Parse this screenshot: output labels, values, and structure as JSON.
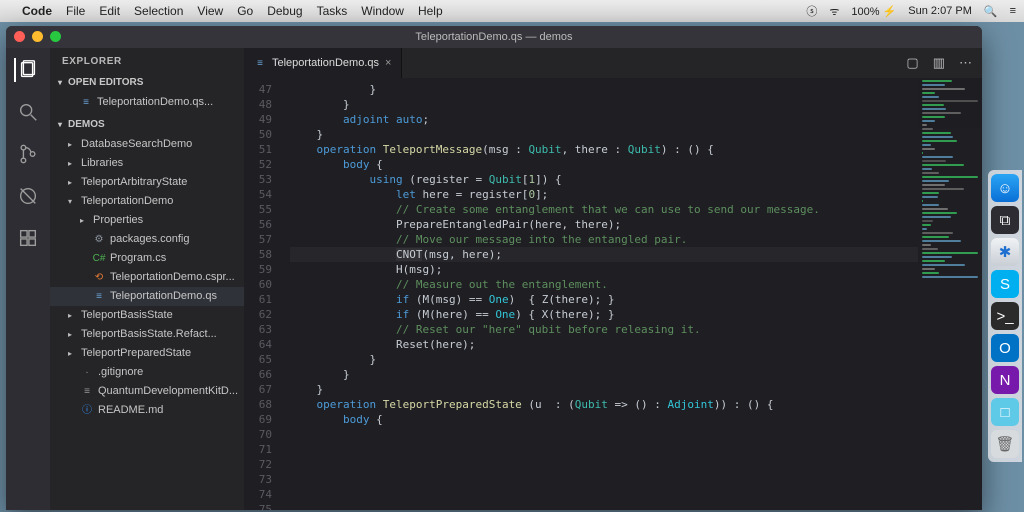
{
  "menubar": {
    "apple": "",
    "app": "Code",
    "items": [
      "File",
      "Edit",
      "Selection",
      "View",
      "Go",
      "Debug",
      "Tasks",
      "Window",
      "Help"
    ],
    "right": {
      "skype": "ⓢ",
      "wifi": "ᯤ",
      "battery": "100% ⚡",
      "time": "Sun 2:07 PM",
      "spotlight": "🔍",
      "menu": "≡"
    }
  },
  "window": {
    "title": "TeleportationDemo.qs — demos"
  },
  "sidebar": {
    "title": "EXPLORER",
    "sections": {
      "openEditors": {
        "label": "OPEN EDITORS",
        "items": [
          {
            "icon": "≡",
            "label": "TeleportationDemo.qs..."
          }
        ]
      },
      "workspace": {
        "label": "DEMOS",
        "items": [
          {
            "l": 1,
            "chev": "▸",
            "label": "DatabaseSearchDemo"
          },
          {
            "l": 1,
            "chev": "▸",
            "label": "Libraries"
          },
          {
            "l": 1,
            "chev": "▸",
            "label": "TeleportArbitraryState"
          },
          {
            "l": 1,
            "chev": "▾",
            "label": "TeleportationDemo"
          },
          {
            "l": 2,
            "chev": "▸",
            "label": "Properties"
          },
          {
            "l": 2,
            "icon": "⚙",
            "label": "packages.config",
            "color": "#8b949e"
          },
          {
            "l": 2,
            "icon": "C#",
            "label": "Program.cs",
            "color": "#4caf50"
          },
          {
            "l": 2,
            "icon": "⟲",
            "label": "TeleportationDemo.cspr...",
            "color": "#e37933"
          },
          {
            "l": 2,
            "icon": "≡",
            "label": "TeleportationDemo.qs",
            "sel": true,
            "color": "#6aa4d8"
          },
          {
            "l": 1,
            "chev": "▸",
            "label": "TeleportBasisState"
          },
          {
            "l": 1,
            "chev": "▸",
            "label": "TeleportBasisState.Refact..."
          },
          {
            "l": 1,
            "chev": "▸",
            "label": "TeleportPreparedState"
          },
          {
            "l": 1,
            "icon": "·",
            "label": ".gitignore"
          },
          {
            "l": 1,
            "icon": "≡",
            "label": "QuantumDevelopmentKitD..."
          },
          {
            "l": 1,
            "icon": "ⓘ",
            "label": "README.md",
            "color": "#3794ff"
          }
        ]
      }
    }
  },
  "tab": {
    "icon": "≡",
    "label": "TeleportationDemo.qs",
    "close": "×"
  },
  "editorActions": {
    "split": "▢",
    "layout": "▥",
    "more": "⋯"
  },
  "code": {
    "start": 47,
    "lines": [
      {
        "t": "            }"
      },
      {
        "t": "        }"
      },
      {
        "t": "        <kw>adjoint</kw> <kw>auto</kw>;"
      },
      {
        "t": "    }"
      },
      {
        "t": ""
      },
      {
        "t": "    <kw>operation</kw> <fn>TeleportMessage</fn>(msg : <ty>Qubit</ty>, there : <ty>Qubit</ty>) : () {"
      },
      {
        "t": "        <kw>body</kw> {"
      },
      {
        "t": "            <kw>using</kw> (register = <ty>Qubit</ty>[<nm>1</nm>]) {"
      },
      {
        "t": "                <kw>let</kw> here = register[<nm>0</nm>];"
      },
      {
        "t": ""
      },
      {
        "t": "                <cm>// Create some entanglement that we can use to send our message.</cm>"
      },
      {
        "t": "                PrepareEntangledPair(here, there);"
      },
      {
        "t": ""
      },
      {
        "t": "                <cm>// Move our message into the entangled pair.</cm>"
      },
      {
        "t": "                <span class=\"hl\">CNOT</span>(msg, here);",
        "hl": true
      },
      {
        "t": "                H(msg);"
      },
      {
        "t": ""
      },
      {
        "t": "                <cm>// Measure out the entanglement.</cm>"
      },
      {
        "t": "                <kw>if</kw> (M(msg) == <ct>One</ct>)  { Z(there); }"
      },
      {
        "t": "                <kw>if</kw> (M(here) == <ct>One</ct>) { X(there); }"
      },
      {
        "t": ""
      },
      {
        "t": "                <cm>// Reset our \"here\" qubit before releasing it.</cm>"
      },
      {
        "t": "                Reset(here);"
      },
      {
        "t": "            }"
      },
      {
        "t": "        }"
      },
      {
        "t": "    }"
      },
      {
        "t": ""
      },
      {
        "t": "    <kw>operation</kw> <fn>TeleportPreparedState</fn> (u  : (<ty>Qubit</ty> => () : <ct>Adjoint</ct>)) : () {"
      },
      {
        "t": "        <kw>body</kw> {"
      }
    ]
  },
  "dock": {
    "items": [
      {
        "name": "finder",
        "bg": "linear-gradient(#2aa5f5,#0a6fd6)",
        "glyph": "☺"
      },
      {
        "name": "vscode",
        "bg": "#2c2c32",
        "glyph": "⧉"
      },
      {
        "name": "safari",
        "bg": "linear-gradient(#f0f2f5,#c9ced5)",
        "glyph": "✱",
        "fg": "#1f6fd0"
      },
      {
        "name": "skype",
        "bg": "#00aff0",
        "glyph": "S"
      },
      {
        "name": "terminal",
        "bg": "#2b2b2b",
        "glyph": ">_"
      },
      {
        "name": "outlook",
        "bg": "#0072c6",
        "glyph": "O"
      },
      {
        "name": "onenote",
        "bg": "#7719aa",
        "glyph": "N"
      },
      {
        "name": "box",
        "bg": "#5fc9e8",
        "glyph": "□"
      },
      {
        "name": "trash",
        "bg": "#d7dbde",
        "glyph": "🗑",
        "fg": "#666"
      }
    ]
  }
}
